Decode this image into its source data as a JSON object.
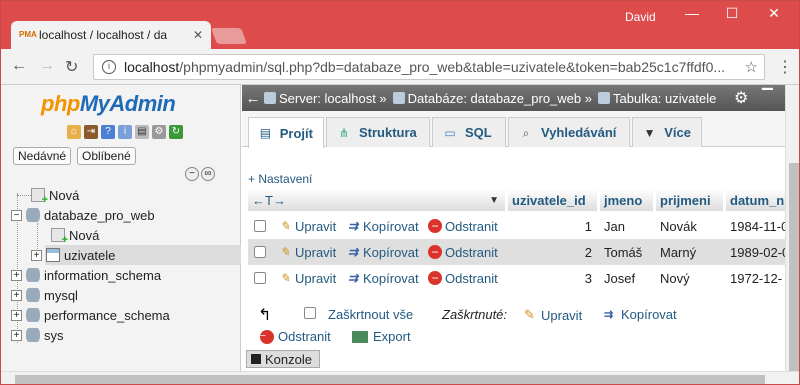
{
  "browser": {
    "tab_title": "localhost / localhost / da",
    "user": "David",
    "url_host": "localhost",
    "url_path": "/phpmyadmin/sql.php?db=databaze_pro_web&table=uzivatele&token=bab25c1c7ffdf0..."
  },
  "sidebar": {
    "logo_php": "php",
    "logo_rest": "MyAdmin",
    "recent_label": "Nedávné",
    "favorites_label": "Oblíbené",
    "tree": [
      {
        "label": "Nová"
      },
      {
        "label": "databaze_pro_web"
      },
      {
        "label": "Nová"
      },
      {
        "label": "uzivatele"
      },
      {
        "label": "information_schema"
      },
      {
        "label": "mysql"
      },
      {
        "label": "performance_schema"
      },
      {
        "label": "sys"
      }
    ]
  },
  "breadcrumb": {
    "server": "Server: localhost »",
    "database": "Databáze: databaze_pro_web »",
    "table": "Tabulka: uzivatele"
  },
  "tabs": [
    {
      "label": "Projít",
      "icon": "browse-icon"
    },
    {
      "label": "Struktura",
      "icon": "structure-icon"
    },
    {
      "label": "SQL",
      "icon": "sql-icon"
    },
    {
      "label": "Vyhledávání",
      "icon": "search-icon"
    },
    {
      "label": "Více",
      "icon": "chevron-down-icon"
    }
  ],
  "settings_link": "+ Nastavení",
  "table": {
    "columns": [
      "uzivatele_id",
      "jmeno",
      "prijmeni",
      "datum_n"
    ],
    "actions": {
      "edit": "Upravit",
      "copy": "Kopírovat",
      "delete": "Odstranit"
    },
    "rows": [
      {
        "id": "1",
        "jmeno": "Jan",
        "prijmeni": "Novák",
        "datum": "1984-11-0"
      },
      {
        "id": "2",
        "jmeno": "Tomáš",
        "prijmeni": "Marný",
        "datum": "1989-02-0"
      },
      {
        "id": "3",
        "jmeno": "Josef",
        "prijmeni": "Nový",
        "datum": "1972-12-"
      }
    ]
  },
  "footer": {
    "check_all": "Zaškrtnout vše",
    "checked_label": "Zaškrtnuté:",
    "edit": "Upravit",
    "copy": "Kopírovat",
    "delete": "Odstranit",
    "export": "Export"
  },
  "console_label": "Konzole"
}
